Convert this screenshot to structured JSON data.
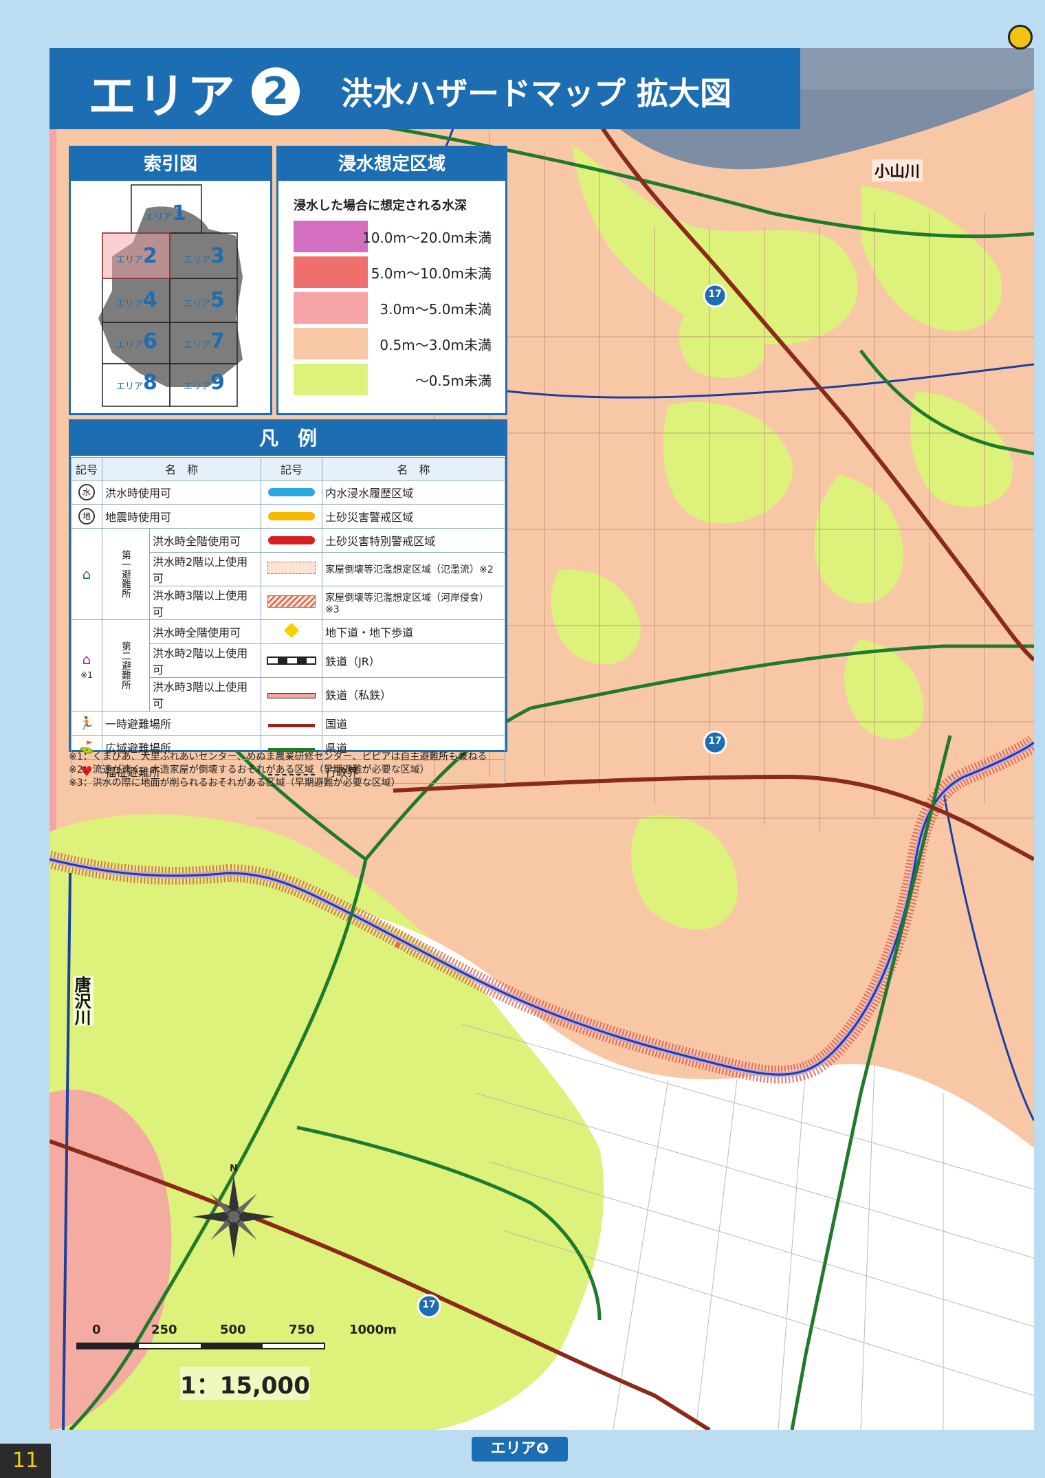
{
  "title": {
    "area_label": "エリア",
    "area_number": "2",
    "subtitle": "洪水ハザードマップ 拡大図"
  },
  "index_map": {
    "heading": "索引図",
    "cells": [
      {
        "prefix": "エリア",
        "number": "1"
      },
      {
        "prefix": "エリア",
        "number": "2"
      },
      {
        "prefix": "エリア",
        "number": "3"
      },
      {
        "prefix": "エリア",
        "number": "4"
      },
      {
        "prefix": "エリア",
        "number": "5"
      },
      {
        "prefix": "エリア",
        "number": "6"
      },
      {
        "prefix": "エリア",
        "number": "7"
      },
      {
        "prefix": "エリア",
        "number": "8"
      },
      {
        "prefix": "エリア",
        "number": "9"
      }
    ]
  },
  "flood_zone": {
    "heading": "浸水想定区域",
    "caption": "浸水した場合に想定される水深",
    "levels": [
      {
        "label": "10.0m～20.0m未満",
        "color": "#d46fbf"
      },
      {
        "label": "5.0m～10.0m未満",
        "color": "#ef6f6c"
      },
      {
        "label": "3.0m～5.0m未満",
        "color": "#f6a3a6"
      },
      {
        "label": "0.5m～3.0m未満",
        "color": "#f8c8a6"
      },
      {
        "label": "～0.5m未満",
        "color": "#dcf27a"
      }
    ]
  },
  "legend": {
    "heading": "凡　例",
    "col_symbol": "記号",
    "col_name": "名　称",
    "left": {
      "flood_use": "洪水時使用可",
      "quake_use": "地震時使用可",
      "group1_label": "第一避難所",
      "group2_label": "第二避難所",
      "all_floors": "洪水時全階使用可",
      "floor2": "洪水時2階以上使用可",
      "floor3": "洪水時3階以上使用可",
      "note1_mark": "※1",
      "temp_evac": "一時避難場所",
      "wide_evac": "広域避難場所",
      "welfare": "福祉避難所"
    },
    "right": [
      "内水浸水履歴区域",
      "土砂災害警戒区域",
      "土砂災害特別警戒区域",
      "家屋倒壊等氾濫想定区域（氾濫流）※2",
      "家屋倒壊等氾濫想定区域（河岸侵食）※3",
      "地下道・地下歩道",
      "鉄道（JR）",
      "鉄道（私鉄）",
      "国道",
      "県道",
      "行政界"
    ]
  },
  "notes": [
    "※1：くまぴあ、大里ふれあいセンター、めぬま農業研修センター、ピピアは自主避難所も兼ねる",
    "※2：流速が速く、木造家屋が倒壊するおそれがある区域（早期避難が必要な区域）",
    "※3：洪水の際に地面が削られるおそれがある区域（早期避難が必要な区域）"
  ],
  "map_labels": {
    "river_top": "小山川",
    "river_left": "唐沢川",
    "route_number": "17",
    "compass_north": "N"
  },
  "scale": {
    "ticks": [
      "0",
      "250",
      "500",
      "750",
      "1000m"
    ],
    "ratio": "1：15,000"
  },
  "footer": {
    "page_number": "11",
    "next_area": "エリア❹"
  },
  "colors": {
    "brand_blue": "#1d6db3",
    "national_road": "#8a2a1a",
    "prefectural_road": "#1f7a2e",
    "river": "#7c8da4",
    "water_channel": "#1a3fa0"
  }
}
